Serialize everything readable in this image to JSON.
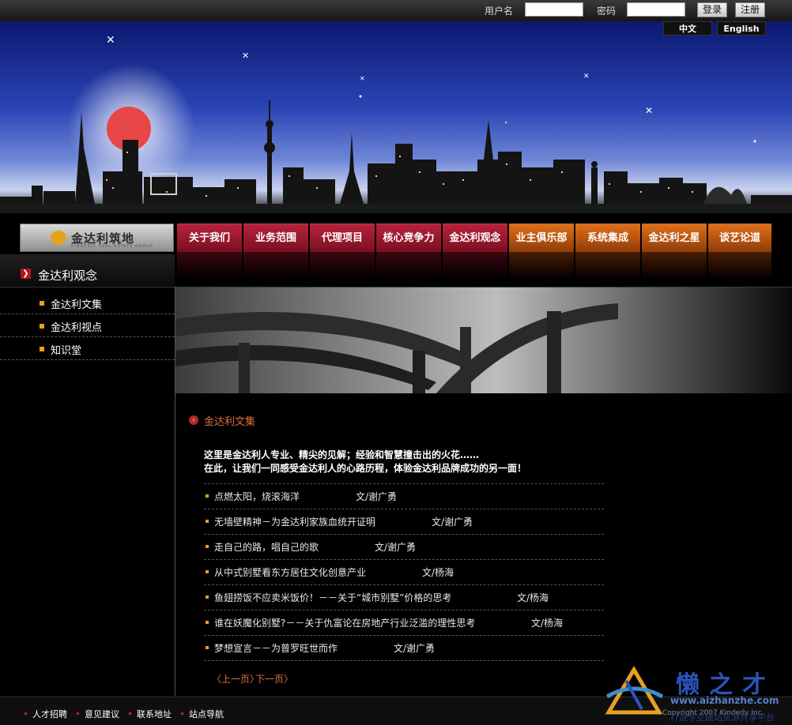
{
  "top": {
    "username_label": "用户名",
    "password_label": "密码",
    "login_label": "登录",
    "register_label": "注册"
  },
  "lang": {
    "chinese": "中文",
    "english": "English"
  },
  "logo": {
    "text": "金达利筑地",
    "subtext": "KINDERLY REAL ESTATE GROUP"
  },
  "nav": [
    {
      "label": "关于我们",
      "color": "red"
    },
    {
      "label": "业务范围",
      "color": "red"
    },
    {
      "label": "代理项目",
      "color": "red"
    },
    {
      "label": "核心竞争力",
      "color": "red"
    },
    {
      "label": "金达利观念",
      "color": "red"
    },
    {
      "label": "业主俱乐部",
      "color": "orange"
    },
    {
      "label": "系统集成",
      "color": "orange"
    },
    {
      "label": "金达利之星",
      "color": "orange"
    },
    {
      "label": "谈艺论道",
      "color": "orange"
    }
  ],
  "section": {
    "title": "金达利观念"
  },
  "sidebar": {
    "items": [
      {
        "label": "金达利文集"
      },
      {
        "label": "金达利视点"
      },
      {
        "label": "知识堂"
      }
    ]
  },
  "content": {
    "title": "金达利文集",
    "intro_line1": "这里是金达利人专业、精尖的见解；经验和智慧撞击出的火花……",
    "intro_line2": "在此，让我们一同感受金达利人的心路历程，体验金达利品牌成功的另一面！",
    "articles": [
      {
        "title": "点燃太阳，烧滚海洋",
        "author": "文/谢广勇"
      },
      {
        "title": "无墙壁精神－为金达利家族血统开证明",
        "author": "文/谢广勇"
      },
      {
        "title": "走自己的路，唱自己的歌",
        "author": "文/谢广勇"
      },
      {
        "title": "从中式别墅看东方居住文化创意产业",
        "author": "文/杨海"
      },
      {
        "title": "鱼翅捞饭不应卖米饭价！－－关于“城市别墅”价格的思考",
        "author": "文/杨海"
      },
      {
        "title": "谁在妖魔化别墅?－－关于仇富论在房地产行业泛滥的理性思考",
        "author": "文/杨海"
      },
      {
        "title": "梦想宣言－－为普罗旺世而作",
        "author": "文/谢广勇"
      }
    ],
    "prev_page": "〈上一页〉",
    "next_page": "下一页〉"
  },
  "footer": {
    "links": [
      {
        "label": "人才招聘"
      },
      {
        "label": "意见建议"
      },
      {
        "label": "联系地址"
      },
      {
        "label": "站点导航"
      }
    ],
    "copyright": "Copyright 2007 Kinderly Inc."
  },
  "watermark": {
    "chars": "懒之才",
    "url": "www.aizhanzhe.com",
    "subtitle": "打造专业建站资源共享平台"
  },
  "colors": {
    "nav_red": "#9b1a2e",
    "nav_orange": "#c85a10",
    "accent_orange": "#e0703a",
    "bullet": "#e8a020",
    "background": "#000000"
  }
}
